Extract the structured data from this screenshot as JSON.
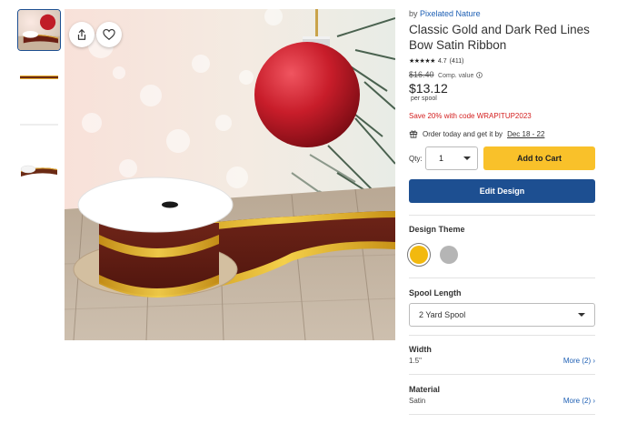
{
  "product": {
    "by_prefix": "by",
    "brand": "Pixelated Nature",
    "title": "Classic Gold and Dark Red Lines Bow Satin Ribbon",
    "stars": "★★★★★",
    "rating": "4.7",
    "review_count": "(411)",
    "original_price": "$16.40",
    "comp_label": "Comp. value",
    "price": "$13.12",
    "unit": "per spool",
    "promo": "Save 20% with code WRAPITUP2023",
    "delivery_prefix": "Order today and get it by",
    "delivery_dates": "Dec 18 - 22"
  },
  "purchase": {
    "qty_label": "Qty:",
    "qty_value": "1",
    "add_to_cart": "Add to Cart",
    "edit_design": "Edit Design"
  },
  "options": {
    "design_theme_label": "Design Theme",
    "themes": [
      {
        "name": "gold",
        "color": "#f2b90f",
        "selected": true
      },
      {
        "name": "silver",
        "color": "#b5b5b5",
        "selected": false
      }
    ],
    "spool_length_label": "Spool Length",
    "spool_length_value": "2 Yard Spool",
    "width_label": "Width",
    "width_value": "1.5\"",
    "width_more": "More (2)",
    "material_label": "Material",
    "material_value": "Satin",
    "material_more": "More (2)"
  },
  "colors": {
    "accent_yellow": "#f9c12a",
    "primary_blue": "#1d4f91",
    "link_blue": "#1d5fb4",
    "promo_red": "#d42020"
  },
  "icons": [
    "share-icon",
    "heart-icon",
    "gift-icon",
    "info-icon",
    "caret-down-icon"
  ]
}
